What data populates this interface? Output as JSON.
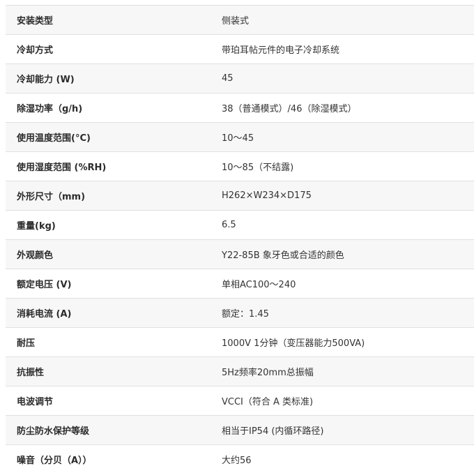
{
  "specs": [
    {
      "label": "安装类型",
      "value": "侧装式"
    },
    {
      "label": "冷却方式",
      "value": "带珀耳帖元件的电子冷却系统"
    },
    {
      "label": "冷却能力 (W)",
      "value": "45"
    },
    {
      "label": "除湿功率（g/h)",
      "value": "38（普通模式）/46（除湿模式）"
    },
    {
      "label": "使用温度范围(°C)",
      "value": "10～45"
    },
    {
      "label": "使用湿度范围 (%RH)",
      "value": "10～85（不结露)"
    },
    {
      "label": "外形尺寸（mm)",
      "value": "H262×W234×D175"
    },
    {
      "label": "重量(kg)",
      "value": "6.5"
    },
    {
      "label": "外观颜色",
      "value": "Y22-85B 象牙色或合适的颜色"
    },
    {
      "label": "额定电压 (V)",
      "value": "单相AC100～240"
    },
    {
      "label": "消耗电流 (A)",
      "value": "额定：1.45"
    },
    {
      "label": "耐压",
      "value": "1000V 1分钟（变压器能力500VA)"
    },
    {
      "label": "抗振性",
      "value": "5Hz频率20mm总振幅"
    },
    {
      "label": "电波调节",
      "value": "VCCI（符合 A 类标准)"
    },
    {
      "label": "防尘防水保护等级",
      "value": "相当于IP54 (内循环路径)"
    },
    {
      "label": "噪音（分贝（A））",
      "value": "大约56"
    }
  ]
}
